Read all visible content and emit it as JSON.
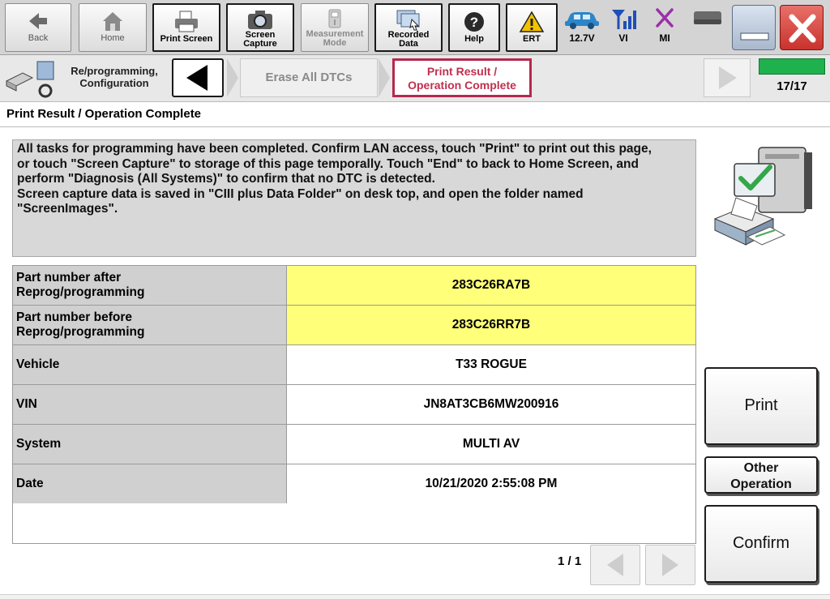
{
  "toolbar": {
    "back": "Back",
    "home": "Home",
    "print_screen": "Print Screen",
    "screen_capture": "Screen\nCapture",
    "measurement_mode": "Measurement\nMode",
    "recorded_data": "Recorded\nData",
    "help": "Help",
    "ert": "ERT",
    "battery_voltage": "12.7V",
    "vi": "VI",
    "mi": "MI"
  },
  "breadcrumb": {
    "section": "Re/programming,\nConfiguration",
    "past_step": "Erase All DTCs",
    "current_step": "Print Result /\nOperation Complete",
    "progress": "17/17",
    "progress_fraction": 1.0
  },
  "page_title": "Print Result / Operation Complete",
  "message": "All tasks for programming have been completed. Confirm LAN access, touch \"Print\" to print out this page,\nor touch \"Screen Capture\" to storage of this page temporally. Touch \"End\" to back to Home Screen, and\nperform \"Diagnosis (All Systems)\" to confirm that no DTC is detected.\nScreen capture data is saved in \"CIII plus Data Folder\" on desk top, and open the folder named\n\"ScreenImages\".",
  "result_rows": [
    {
      "label": "Part number after\nReprog/programming",
      "value": "283C26RA7B",
      "highlight": true
    },
    {
      "label": "Part number before\nReprog/programming",
      "value": "283C26RR7B",
      "highlight": true
    },
    {
      "label": "Vehicle",
      "value": "T33 ROGUE",
      "highlight": false
    },
    {
      "label": "VIN",
      "value": "JN8AT3CB6MW200916",
      "highlight": false
    },
    {
      "label": "System",
      "value": "MULTI AV",
      "highlight": false
    },
    {
      "label": "Date",
      "value": "10/21/2020 2:55:08 PM",
      "highlight": false
    }
  ],
  "pagination": {
    "indicator": "1 / 1"
  },
  "actions": {
    "print": "Print",
    "other_operation": "Other\nOperation",
    "confirm": "Confirm"
  },
  "colors": {
    "highlight": "#ffff7a",
    "current_step_border": "#b5294e",
    "progress_fill": "#1fb14d",
    "close_button": "#d9473f"
  },
  "icons": {
    "back": "left-arrow-icon",
    "home": "house-icon",
    "print_screen": "printer-icon",
    "screen_capture": "camera-icon",
    "measurement_mode": "meter-icon",
    "recorded_data": "recorded-data-icon",
    "help": "question-icon",
    "ert": "warning-icon",
    "battery": "car-icon",
    "vi": "signal-icon",
    "mi": "x-mark-icon"
  }
}
